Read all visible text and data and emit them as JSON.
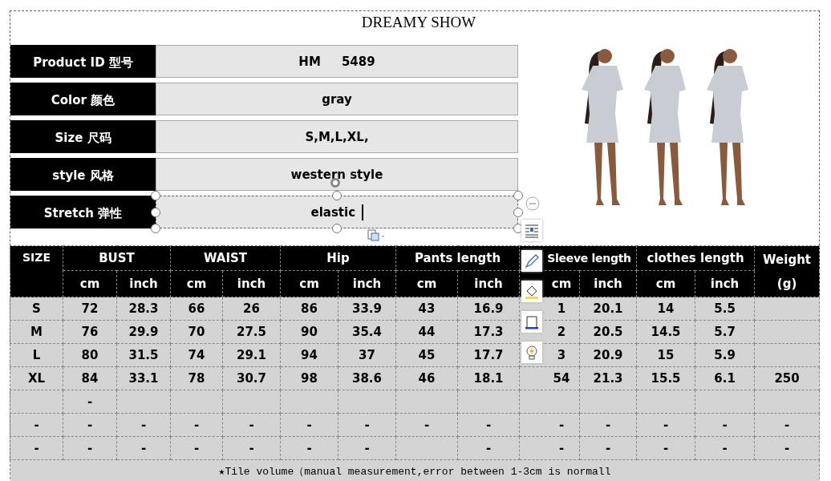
{
  "title": "DREAMY SHOW",
  "info": [
    {
      "label": "Product ID 型号",
      "value": "HM     5489",
      "editing": false
    },
    {
      "label": "Color 颜色",
      "value": "gray",
      "editing": false
    },
    {
      "label": "Size 尺码",
      "value": "S,M,L,XL,",
      "editing": false
    },
    {
      "label": "style 风格",
      "value": "western style",
      "editing": false
    },
    {
      "label": "Stretch 弹性",
      "value": "elastic",
      "editing": true
    }
  ],
  "size_table": {
    "groups": [
      "BUST",
      "WAIST",
      "Hip",
      "Pants length",
      "Sleeve length",
      "clothes length"
    ],
    "size_heading": "SIZE",
    "weight_heading": "Weight\n(g)",
    "units": [
      "cm",
      "inch",
      "cm",
      "inch",
      "cm",
      "inch",
      "cm",
      "inch",
      "cm",
      "inch",
      "cm",
      "inch"
    ],
    "rows": [
      [
        "S",
        "72",
        "28.3",
        "66",
        "26",
        "86",
        "33.9",
        "43",
        "16.9",
        "1",
        "20.1",
        "14",
        "5.5",
        null
      ],
      [
        "M",
        "76",
        "29.9",
        "70",
        "27.5",
        "90",
        "35.4",
        "44",
        "17.3",
        "2",
        "20.5",
        "14.5",
        "5.7",
        null
      ],
      [
        "L",
        "80",
        "31.5",
        "74",
        "29.1",
        "94",
        "37",
        "45",
        "17.7",
        "3",
        "20.9",
        "15",
        "5.9",
        null
      ],
      [
        "XL",
        "84",
        "33.1",
        "78",
        "30.7",
        "98",
        "38.6",
        "46",
        "18.1",
        "54",
        "21.3",
        "15.5",
        "6.1",
        "250"
      ],
      [
        null,
        "-",
        null,
        null,
        null,
        null,
        null,
        null,
        null,
        null,
        null,
        null,
        null,
        null
      ],
      [
        "-",
        "-",
        "-",
        "-",
        "-",
        "-",
        "-",
        "-",
        "-",
        "-",
        "-",
        "-",
        "-",
        "-"
      ],
      [
        "-",
        "-",
        "-",
        "-",
        "-",
        "-",
        "-",
        null,
        "-",
        "-",
        "-",
        "-",
        "-",
        "-"
      ]
    ],
    "note": "★Tile volume（manual measurement,error between 1-3cm is normall"
  }
}
